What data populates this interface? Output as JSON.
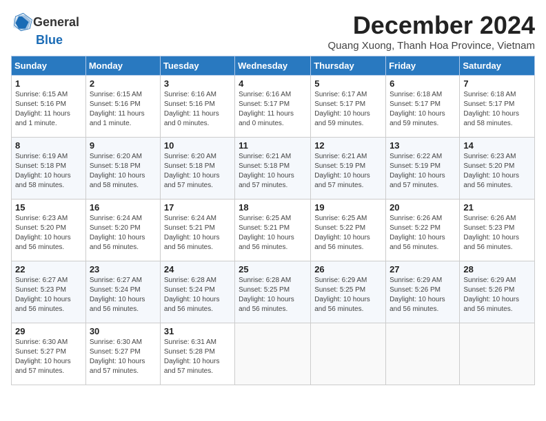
{
  "header": {
    "logo_general": "General",
    "logo_blue": "Blue",
    "month_title": "December 2024",
    "location": "Quang Xuong, Thanh Hoa Province, Vietnam"
  },
  "weekdays": [
    "Sunday",
    "Monday",
    "Tuesday",
    "Wednesday",
    "Thursday",
    "Friday",
    "Saturday"
  ],
  "weeks": [
    [
      {
        "day": "1",
        "info": "Sunrise: 6:15 AM\nSunset: 5:16 PM\nDaylight: 11 hours and 1 minute."
      },
      {
        "day": "2",
        "info": "Sunrise: 6:15 AM\nSunset: 5:16 PM\nDaylight: 11 hours and 1 minute."
      },
      {
        "day": "3",
        "info": "Sunrise: 6:16 AM\nSunset: 5:16 PM\nDaylight: 11 hours and 0 minutes."
      },
      {
        "day": "4",
        "info": "Sunrise: 6:16 AM\nSunset: 5:17 PM\nDaylight: 11 hours and 0 minutes."
      },
      {
        "day": "5",
        "info": "Sunrise: 6:17 AM\nSunset: 5:17 PM\nDaylight: 10 hours and 59 minutes."
      },
      {
        "day": "6",
        "info": "Sunrise: 6:18 AM\nSunset: 5:17 PM\nDaylight: 10 hours and 59 minutes."
      },
      {
        "day": "7",
        "info": "Sunrise: 6:18 AM\nSunset: 5:17 PM\nDaylight: 10 hours and 58 minutes."
      }
    ],
    [
      {
        "day": "8",
        "info": "Sunrise: 6:19 AM\nSunset: 5:18 PM\nDaylight: 10 hours and 58 minutes."
      },
      {
        "day": "9",
        "info": "Sunrise: 6:20 AM\nSunset: 5:18 PM\nDaylight: 10 hours and 58 minutes."
      },
      {
        "day": "10",
        "info": "Sunrise: 6:20 AM\nSunset: 5:18 PM\nDaylight: 10 hours and 57 minutes."
      },
      {
        "day": "11",
        "info": "Sunrise: 6:21 AM\nSunset: 5:18 PM\nDaylight: 10 hours and 57 minutes."
      },
      {
        "day": "12",
        "info": "Sunrise: 6:21 AM\nSunset: 5:19 PM\nDaylight: 10 hours and 57 minutes."
      },
      {
        "day": "13",
        "info": "Sunrise: 6:22 AM\nSunset: 5:19 PM\nDaylight: 10 hours and 57 minutes."
      },
      {
        "day": "14",
        "info": "Sunrise: 6:23 AM\nSunset: 5:20 PM\nDaylight: 10 hours and 56 minutes."
      }
    ],
    [
      {
        "day": "15",
        "info": "Sunrise: 6:23 AM\nSunset: 5:20 PM\nDaylight: 10 hours and 56 minutes."
      },
      {
        "day": "16",
        "info": "Sunrise: 6:24 AM\nSunset: 5:20 PM\nDaylight: 10 hours and 56 minutes."
      },
      {
        "day": "17",
        "info": "Sunrise: 6:24 AM\nSunset: 5:21 PM\nDaylight: 10 hours and 56 minutes."
      },
      {
        "day": "18",
        "info": "Sunrise: 6:25 AM\nSunset: 5:21 PM\nDaylight: 10 hours and 56 minutes."
      },
      {
        "day": "19",
        "info": "Sunrise: 6:25 AM\nSunset: 5:22 PM\nDaylight: 10 hours and 56 minutes."
      },
      {
        "day": "20",
        "info": "Sunrise: 6:26 AM\nSunset: 5:22 PM\nDaylight: 10 hours and 56 minutes."
      },
      {
        "day": "21",
        "info": "Sunrise: 6:26 AM\nSunset: 5:23 PM\nDaylight: 10 hours and 56 minutes."
      }
    ],
    [
      {
        "day": "22",
        "info": "Sunrise: 6:27 AM\nSunset: 5:23 PM\nDaylight: 10 hours and 56 minutes."
      },
      {
        "day": "23",
        "info": "Sunrise: 6:27 AM\nSunset: 5:24 PM\nDaylight: 10 hours and 56 minutes."
      },
      {
        "day": "24",
        "info": "Sunrise: 6:28 AM\nSunset: 5:24 PM\nDaylight: 10 hours and 56 minutes."
      },
      {
        "day": "25",
        "info": "Sunrise: 6:28 AM\nSunset: 5:25 PM\nDaylight: 10 hours and 56 minutes."
      },
      {
        "day": "26",
        "info": "Sunrise: 6:29 AM\nSunset: 5:25 PM\nDaylight: 10 hours and 56 minutes."
      },
      {
        "day": "27",
        "info": "Sunrise: 6:29 AM\nSunset: 5:26 PM\nDaylight: 10 hours and 56 minutes."
      },
      {
        "day": "28",
        "info": "Sunrise: 6:29 AM\nSunset: 5:26 PM\nDaylight: 10 hours and 56 minutes."
      }
    ],
    [
      {
        "day": "29",
        "info": "Sunrise: 6:30 AM\nSunset: 5:27 PM\nDaylight: 10 hours and 57 minutes."
      },
      {
        "day": "30",
        "info": "Sunrise: 6:30 AM\nSunset: 5:27 PM\nDaylight: 10 hours and 57 minutes."
      },
      {
        "day": "31",
        "info": "Sunrise: 6:31 AM\nSunset: 5:28 PM\nDaylight: 10 hours and 57 minutes."
      },
      {
        "day": "",
        "info": ""
      },
      {
        "day": "",
        "info": ""
      },
      {
        "day": "",
        "info": ""
      },
      {
        "day": "",
        "info": ""
      }
    ]
  ]
}
